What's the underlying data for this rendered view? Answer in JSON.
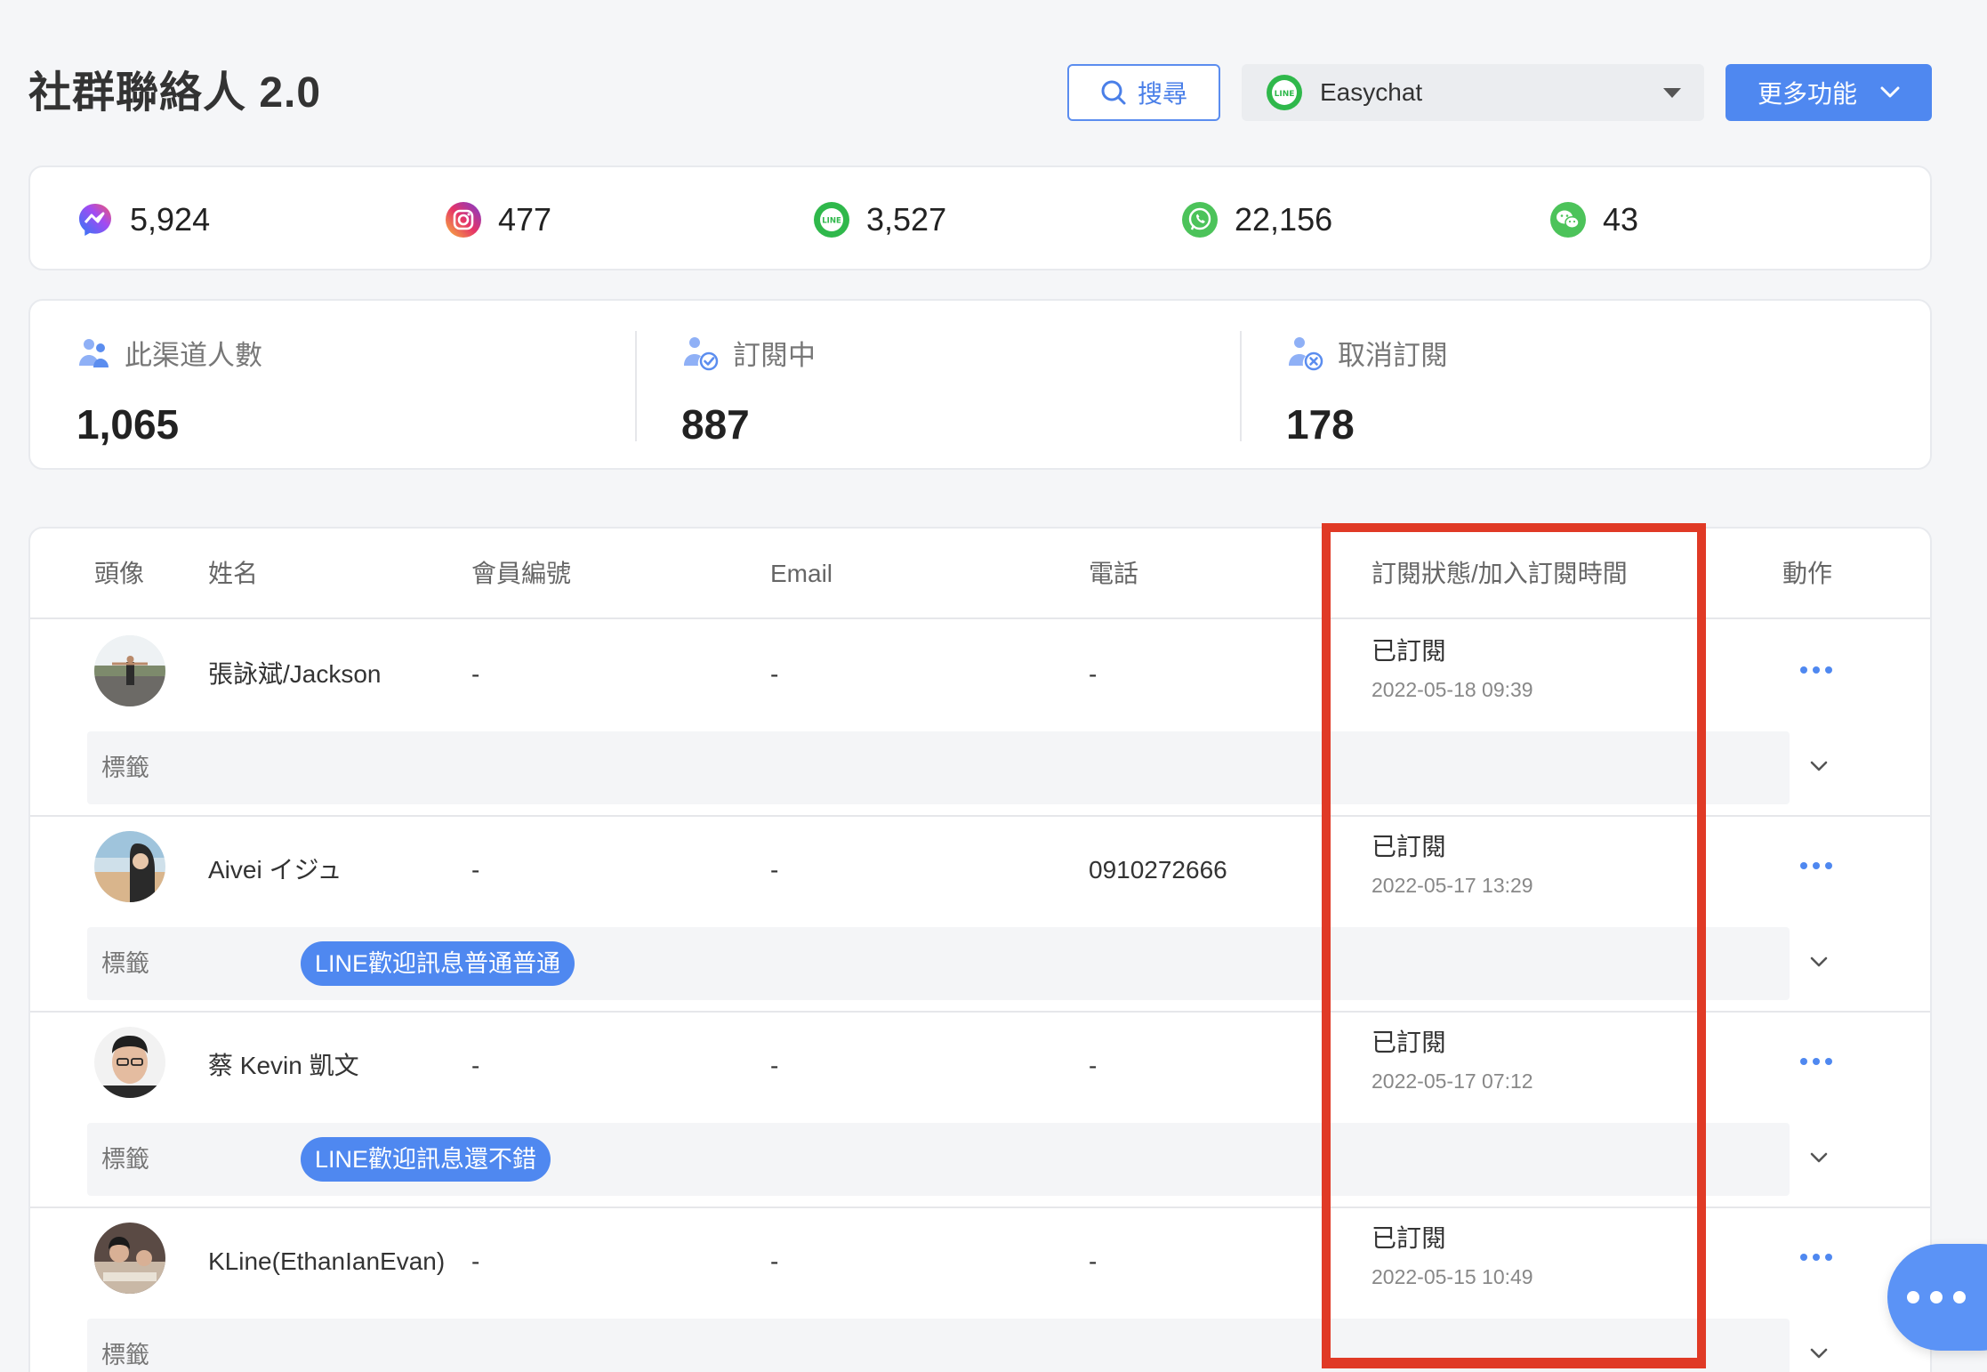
{
  "header": {
    "title": "社群聯絡人 2.0",
    "search_label": "搜尋",
    "channel": "Easychat",
    "more_label": "更多功能"
  },
  "channel_stats": [
    {
      "icon": "messenger-icon",
      "count": "5,924"
    },
    {
      "icon": "instagram-icon",
      "count": "477"
    },
    {
      "icon": "line-icon",
      "count": "3,527"
    },
    {
      "icon": "whatsapp-icon",
      "count": "22,156"
    },
    {
      "icon": "wechat-icon",
      "count": "43"
    }
  ],
  "metrics": [
    {
      "icon": "users-icon",
      "label": "此渠道人數",
      "value": "1,065"
    },
    {
      "icon": "user-check-icon",
      "label": "訂閱中",
      "value": "887"
    },
    {
      "icon": "user-remove-icon",
      "label": "取消訂閱",
      "value": "178"
    }
  ],
  "table": {
    "headers": {
      "avatar": "頭像",
      "name": "姓名",
      "member_id": "會員編號",
      "email": "Email",
      "phone": "電話",
      "status": "訂閱狀態/加入訂閱時間",
      "action": "動作"
    },
    "tag_label": "標籤",
    "rows": [
      {
        "name": "張詠斌/Jackson",
        "member_id": "-",
        "email": "-",
        "phone": "-",
        "status": "已訂閱",
        "time": "2022-05-18 09:39",
        "tag": ""
      },
      {
        "name": "Aivei イジュ",
        "member_id": "-",
        "email": "-",
        "phone": "0910272666",
        "status": "已訂閱",
        "time": "2022-05-17 13:29",
        "tag": "LINE歡迎訊息普通普通"
      },
      {
        "name": "蔡 Kevin 凱文",
        "member_id": "-",
        "email": "-",
        "phone": "-",
        "status": "已訂閱",
        "time": "2022-05-17 07:12",
        "tag": "LINE歡迎訊息還不錯"
      },
      {
        "name": "KLine(EthanIanEvan)",
        "member_id": "-",
        "email": "-",
        "phone": "-",
        "status": "已訂閱",
        "time": "2022-05-15 10:49",
        "tag": ""
      }
    ]
  },
  "colors": {
    "accent": "#4f88f0",
    "highlight": "#e03a26",
    "line_green": "#2fb84b"
  }
}
